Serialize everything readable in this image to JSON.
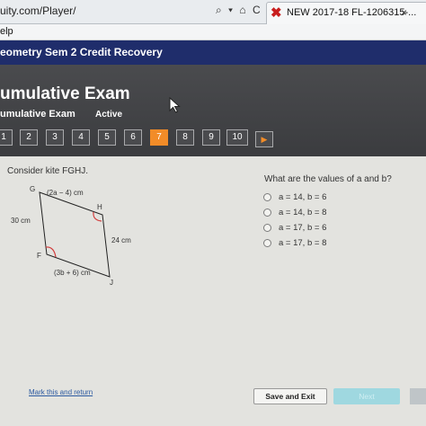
{
  "browser": {
    "url": "uity.com/Player/",
    "address_icons": "⌕ ▾ ⌂ C",
    "tab_title": "NEW 2017-18 FL-1206315-...",
    "tab_close": "×",
    "menu_help": "elp"
  },
  "course": {
    "title": "eometry Sem 2 Credit Recovery"
  },
  "exam": {
    "title": "umulative Exam",
    "subtitle": "umulative Exam",
    "status": "Active",
    "questions": [
      "1",
      "2",
      "3",
      "4",
      "5",
      "6",
      "7",
      "8",
      "9",
      "10"
    ],
    "current_question": "7",
    "next_arrow": "▶"
  },
  "problem": {
    "prompt": "Consider kite FGHJ.",
    "figure": {
      "vertex_g": "G",
      "vertex_h": "H",
      "vertex_f": "F",
      "vertex_j": "J",
      "label_top": "(2a − 4) cm",
      "label_left": "30 cm",
      "label_right": "24 cm",
      "label_bottom": "(3b + 6) cm"
    },
    "question": "What are the values of a and b?",
    "choices": [
      "a = 14, b = 6",
      "a = 14, b = 8",
      "a = 17, b = 6",
      "a = 17, b = 8"
    ]
  },
  "footer": {
    "mark_link": "Mark this and return",
    "save_label": "Save and Exit",
    "next_label": "Next"
  },
  "colors": {
    "accent": "#f28c28",
    "course_bar": "#1f2d6b",
    "header": "#3f4043",
    "next_button": "#9fd8e0"
  }
}
